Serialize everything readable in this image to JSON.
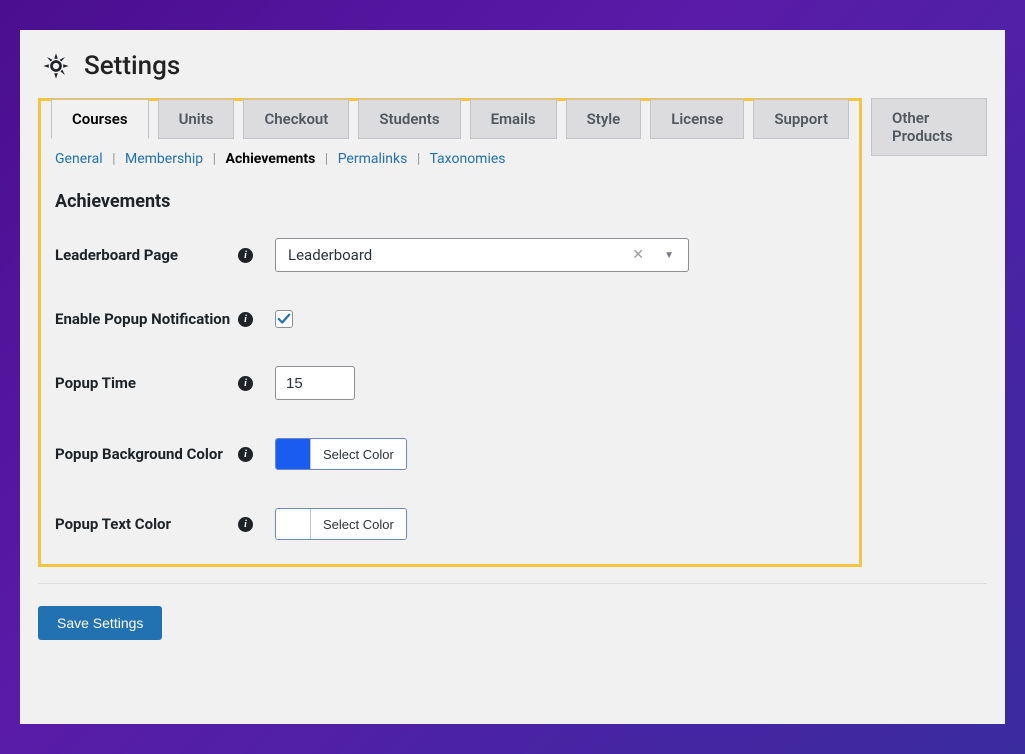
{
  "header": {
    "title": "Settings"
  },
  "tabs": {
    "items": [
      "Courses",
      "Units",
      "Checkout",
      "Students",
      "Emails",
      "Style",
      "License",
      "Support"
    ],
    "outside": "Other Products",
    "active": "Courses"
  },
  "subtabs": {
    "items": [
      "General",
      "Membership",
      "Achievements",
      "Permalinks",
      "Taxonomies"
    ],
    "active": "Achievements"
  },
  "section": {
    "title": "Achievements"
  },
  "fields": {
    "leaderboard": {
      "label": "Leaderboard Page",
      "value": "Leaderboard"
    },
    "enable_popup": {
      "label": "Enable Popup Notification",
      "checked": true
    },
    "popup_time": {
      "label": "Popup Time",
      "value": "15"
    },
    "popup_bg": {
      "label": "Popup Background Color",
      "color": "#1a5cf0",
      "button": "Select Color"
    },
    "popup_text": {
      "label": "Popup Text Color",
      "color": "#ffffff",
      "button": "Select Color"
    }
  },
  "actions": {
    "save": "Save Settings"
  }
}
